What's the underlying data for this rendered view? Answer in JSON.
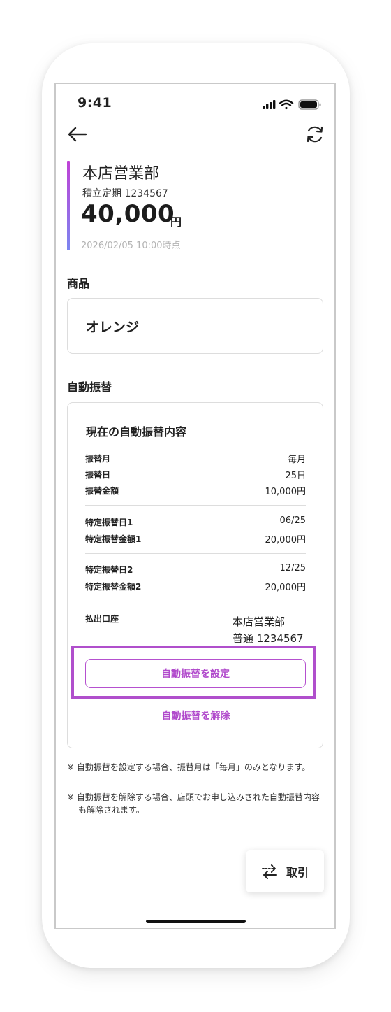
{
  "status_bar": {
    "time": "9:41"
  },
  "account": {
    "branch": "本店営業部",
    "account_number": "積立定期 1234567",
    "balance": "40,000",
    "balance_unit": "円",
    "as_of": "2026/02/05 10:00時点"
  },
  "product": {
    "section_title": "商品",
    "name": "オレンジ"
  },
  "auto_transfer": {
    "section_title": "自動振替",
    "heading": "現在の自動振替内容",
    "groups": [
      [
        {
          "label": "振替月",
          "value": "毎月"
        },
        {
          "label": "振替日",
          "value": "25日"
        },
        {
          "label": "振替金額",
          "value": "10,000円"
        }
      ],
      [
        {
          "label": "特定振替日1",
          "value": "06/25"
        },
        {
          "label": "特定振替金額1",
          "value": "20,000円"
        }
      ],
      [
        {
          "label": "特定振替日2",
          "value": "12/25"
        },
        {
          "label": "特定振替金額2",
          "value": "20,000円"
        }
      ]
    ],
    "withdrawal_account": {
      "label": "払出口座",
      "branch": "本店営業部",
      "account": "普通 1234567"
    },
    "set_button_label": "自動振替を設定",
    "cancel_link_label": "自動振替を解除"
  },
  "notes": [
    "※ 自動振替を設定する場合、振替月は「毎月」のみとなります。",
    "※ 自動振替を解除する場合、店頭でお申し込みされた自動振替内容も解除されます。"
  ],
  "fab": {
    "label": "取引",
    "icon": "transfer-arrows-icon"
  },
  "colors": {
    "accent_purple": "#b14bcc",
    "accent_gradient_top": "#c041d6",
    "accent_gradient_bottom": "#7c86f0",
    "text_muted": "#b3b3b3",
    "border": "#dddddd"
  }
}
